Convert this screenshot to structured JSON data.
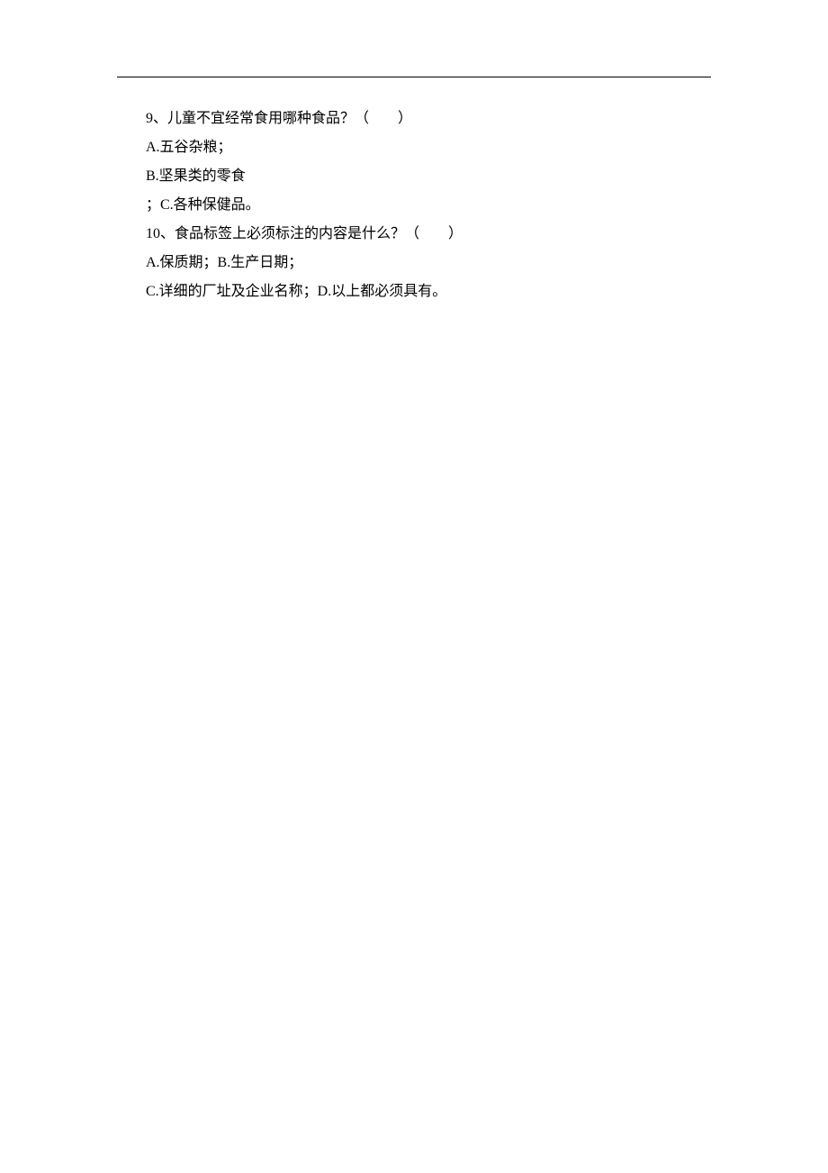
{
  "questions": [
    {
      "number": "9、",
      "text": "儿童不宜经常食用哪种食品？（　　）",
      "options": [
        "A.五谷杂粮；",
        "B.坚果类的零食",
        "；C.各种保健品。"
      ]
    },
    {
      "number": "10、",
      "text": "食品标签上必须标注的内容是什么？（　　）",
      "options": [
        "A.保质期；B.生产日期；",
        "C.详细的厂址及企业名称；D.以上都必须具有。"
      ]
    }
  ]
}
